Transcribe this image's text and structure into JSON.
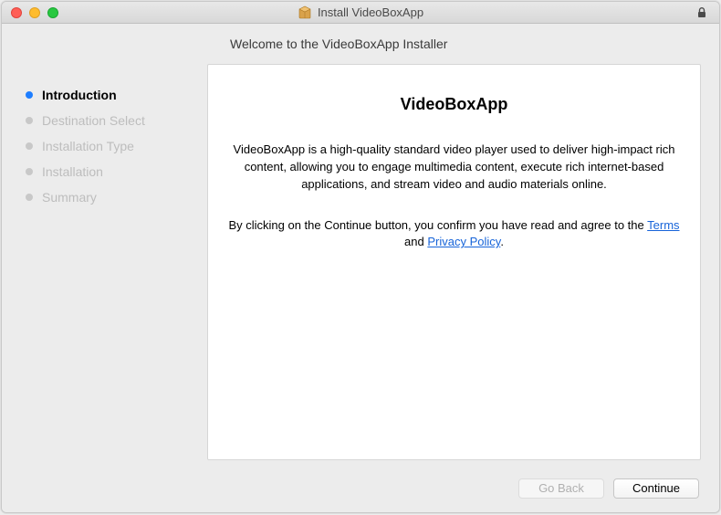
{
  "window": {
    "title": "Install VideoBoxApp"
  },
  "header": {
    "title": "Welcome to the VideoBoxApp Installer"
  },
  "sidebar": {
    "items": [
      {
        "label": "Introduction"
      },
      {
        "label": "Destination Select"
      },
      {
        "label": "Installation Type"
      },
      {
        "label": "Installation"
      },
      {
        "label": "Summary"
      }
    ]
  },
  "panel": {
    "heading": "VideoBoxApp",
    "body": "VideoBoxApp is a high-quality standard video player used to deliver high-impact rich content, allowing you to engage multimedia content, execute rich internet-based applications, and stream video and audio materials online.",
    "consent_pre": "By clicking on the Continue button, you confirm you have read and agree to the ",
    "terms_label": "Terms",
    "consent_mid": " and ",
    "privacy_label": "Privacy Policy",
    "consent_end": "."
  },
  "buttons": {
    "go_back": "Go Back",
    "continue": "Continue"
  }
}
